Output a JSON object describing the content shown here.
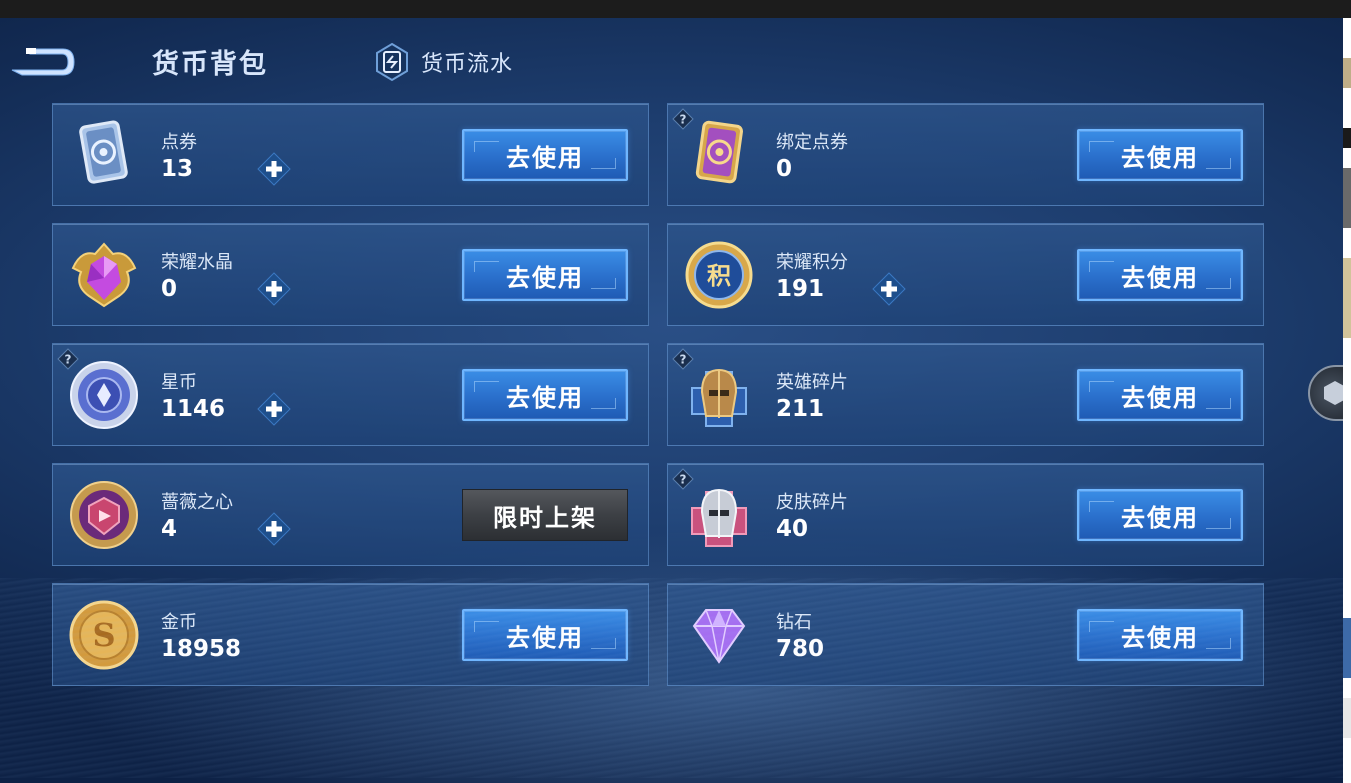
{
  "header": {
    "title": "货币背包",
    "flow_tab_label": "货币流水"
  },
  "cards": [
    {
      "name": "点券",
      "value": "13",
      "button": "去使用",
      "icon": "voucher-card-icon",
      "has_plus": true,
      "has_help": false
    },
    {
      "name": "绑定点券",
      "value": "0",
      "button": "去使用",
      "icon": "bound-voucher-card-icon",
      "has_plus": false,
      "has_help": true
    },
    {
      "name": "荣耀水晶",
      "value": "0",
      "button": "去使用",
      "icon": "glory-crystal-icon",
      "has_plus": true,
      "has_help": false
    },
    {
      "name": "荣耀积分",
      "value": "191",
      "button": "去使用",
      "icon": "glory-points-icon",
      "has_plus": true,
      "has_help": false
    },
    {
      "name": "星币",
      "value": "1146",
      "button": "去使用",
      "icon": "star-coin-icon",
      "has_plus": true,
      "has_help": true
    },
    {
      "name": "英雄碎片",
      "value": "211",
      "button": "去使用",
      "icon": "hero-fragment-icon",
      "has_plus": false,
      "has_help": true
    },
    {
      "name": "蔷薇之心",
      "value": "4",
      "button": "限时上架",
      "icon": "rose-heart-icon",
      "has_plus": true,
      "has_help": false
    },
    {
      "name": "皮肤碎片",
      "value": "40",
      "button": "去使用",
      "icon": "skin-fragment-icon",
      "has_plus": false,
      "has_help": true
    },
    {
      "name": "金币",
      "value": "18958",
      "button": "去使用",
      "icon": "gold-coin-icon",
      "has_plus": false,
      "has_help": false
    },
    {
      "name": "钻石",
      "value": "780",
      "button": "去使用",
      "icon": "diamond-icon",
      "has_plus": false,
      "has_help": false
    }
  ],
  "colors": {
    "button_blue": "#2a6fcb",
    "button_border": "#6fb6ff",
    "limited_button": "#3d4045",
    "background": "#1d3d6e"
  }
}
